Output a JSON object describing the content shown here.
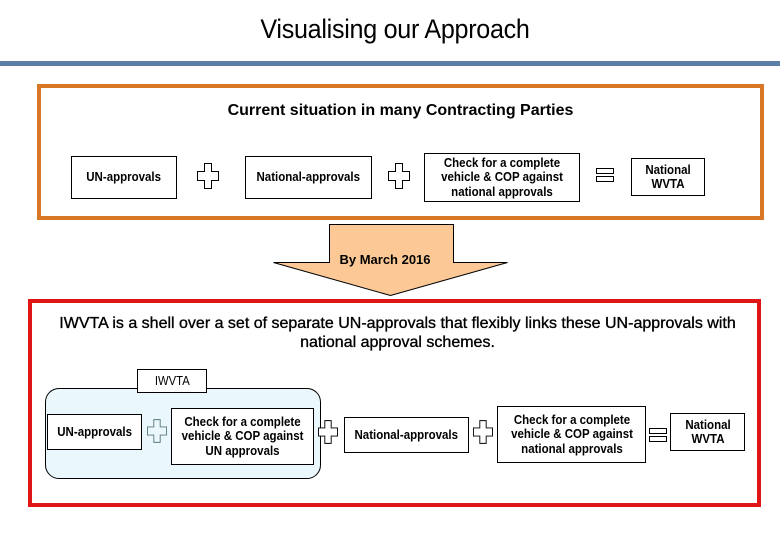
{
  "slide": {
    "title": "Visualising our Approach"
  },
  "colors": {
    "title_rule": "#5b7fa6",
    "current_frame": "#d97726",
    "future_frame": "#e01515",
    "arrow_fill": "#fcc996",
    "shell_fill": "#eaf7fc"
  },
  "current_situation": {
    "heading": "Current situation in many Contracting Parties",
    "boxes": [
      "UN-approvals",
      "National-approvals",
      "Check for a complete vehicle & COP against national approvals",
      "National WVTA"
    ],
    "operators": [
      "plus-icon",
      "plus-icon",
      "equals-icon"
    ]
  },
  "transition": {
    "label": "By March 2016",
    "icon": "down-arrow-icon"
  },
  "future": {
    "heading": "IWVTA is a shell over a set of separate UN-approvals that flexibly links these UN-approvals with national approval schemes.",
    "shell_label": "IWVTA",
    "boxes": [
      "UN-approvals",
      "Check for a complete vehicle & COP against UN approvals",
      "National-approvals",
      "Check for a complete vehicle & COP against national approvals",
      "National WVTA"
    ],
    "operators": [
      "plus-icon",
      "plus-icon",
      "plus-icon",
      "equals-icon"
    ]
  }
}
